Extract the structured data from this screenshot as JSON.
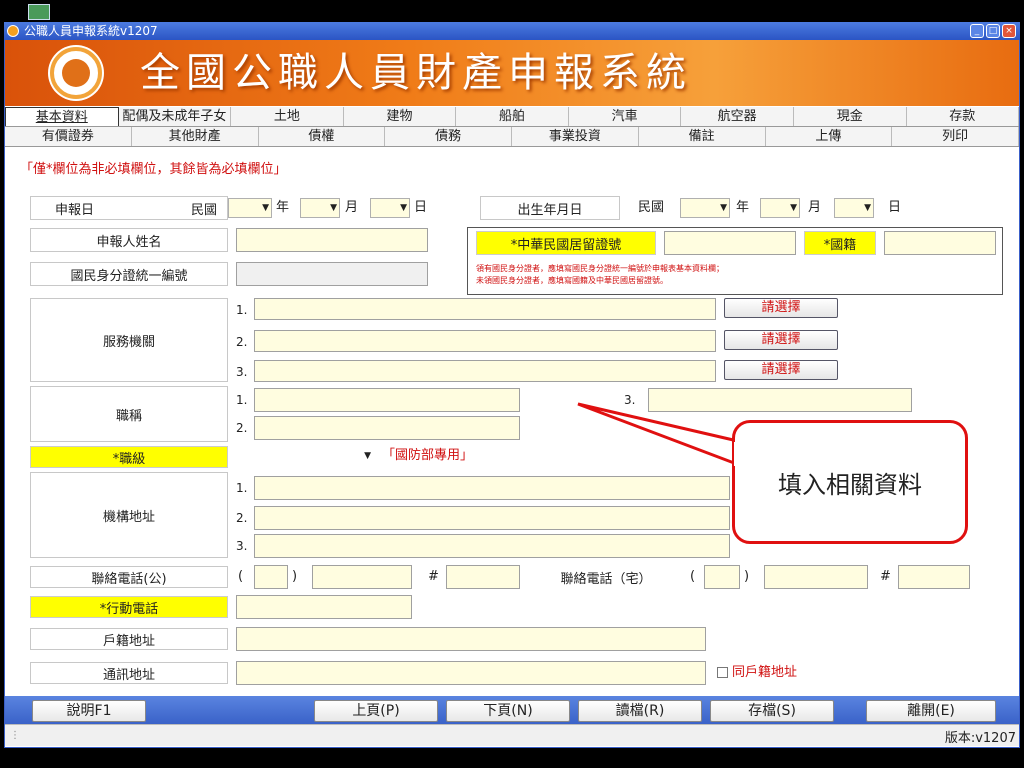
{
  "window": {
    "title": "公職人員申報系統v1207",
    "version": "版本:v1207"
  },
  "banner": {
    "title": "全國公職人員財產申報系統"
  },
  "tabs_row1": [
    "基本資料",
    "配偶及未成年子女",
    "土地",
    "建物",
    "船舶",
    "汽車",
    "航空器",
    "現金",
    "存款"
  ],
  "tabs_row2": [
    "有價證券",
    "其他財產",
    "債權",
    "債務",
    "事業投資",
    "備註",
    "上傳",
    "列印"
  ],
  "notice": "「僅*欄位為非必填欄位，其餘皆為必填欄位」",
  "form": {
    "report_date_label": "申報日",
    "minguo": "民國",
    "year": "年",
    "month": "月",
    "day": "日",
    "birth_label": "出生年月日",
    "name_label": "申報人姓名",
    "id_label": "國民身分證統一編號",
    "residence_label": "*中華民國居留證號",
    "nationality_label": "*國籍",
    "id_note_1": "領有國民身分證者，應填寫國民身分證統一編號於申報表基本資料欄；",
    "id_note_2": "未領國民身分證者，應填寫國籍及中華民國居留證號。",
    "agency_label": "服務機關",
    "select_btn": "請選擇",
    "title_label": "職稱",
    "rank_label": "*職級",
    "rank_note": "「國防部專用」",
    "address_label": "機構地址",
    "phone_office_label": "聯絡電話(公)",
    "phone_home_label": "聯絡電話（宅）",
    "mobile_label": "*行動電話",
    "household_label": "戶籍地址",
    "mail_label": "通訊地址",
    "same_addr": "同戶籍地址",
    "n1": "1.",
    "n2": "2.",
    "n3": "3.",
    "lp": "(",
    "rp": ")",
    "hash": "#"
  },
  "callout": "填入相關資料",
  "buttons": {
    "help": "說明F1",
    "prev": "上頁(P)",
    "next": "下頁(N)",
    "read": "讀檔(R)",
    "save": "存檔(S)",
    "exit": "離開(E)"
  },
  "colors": {
    "accent": "#d01010",
    "highlight": "#ffff00",
    "input_bg": "#fffde0"
  }
}
